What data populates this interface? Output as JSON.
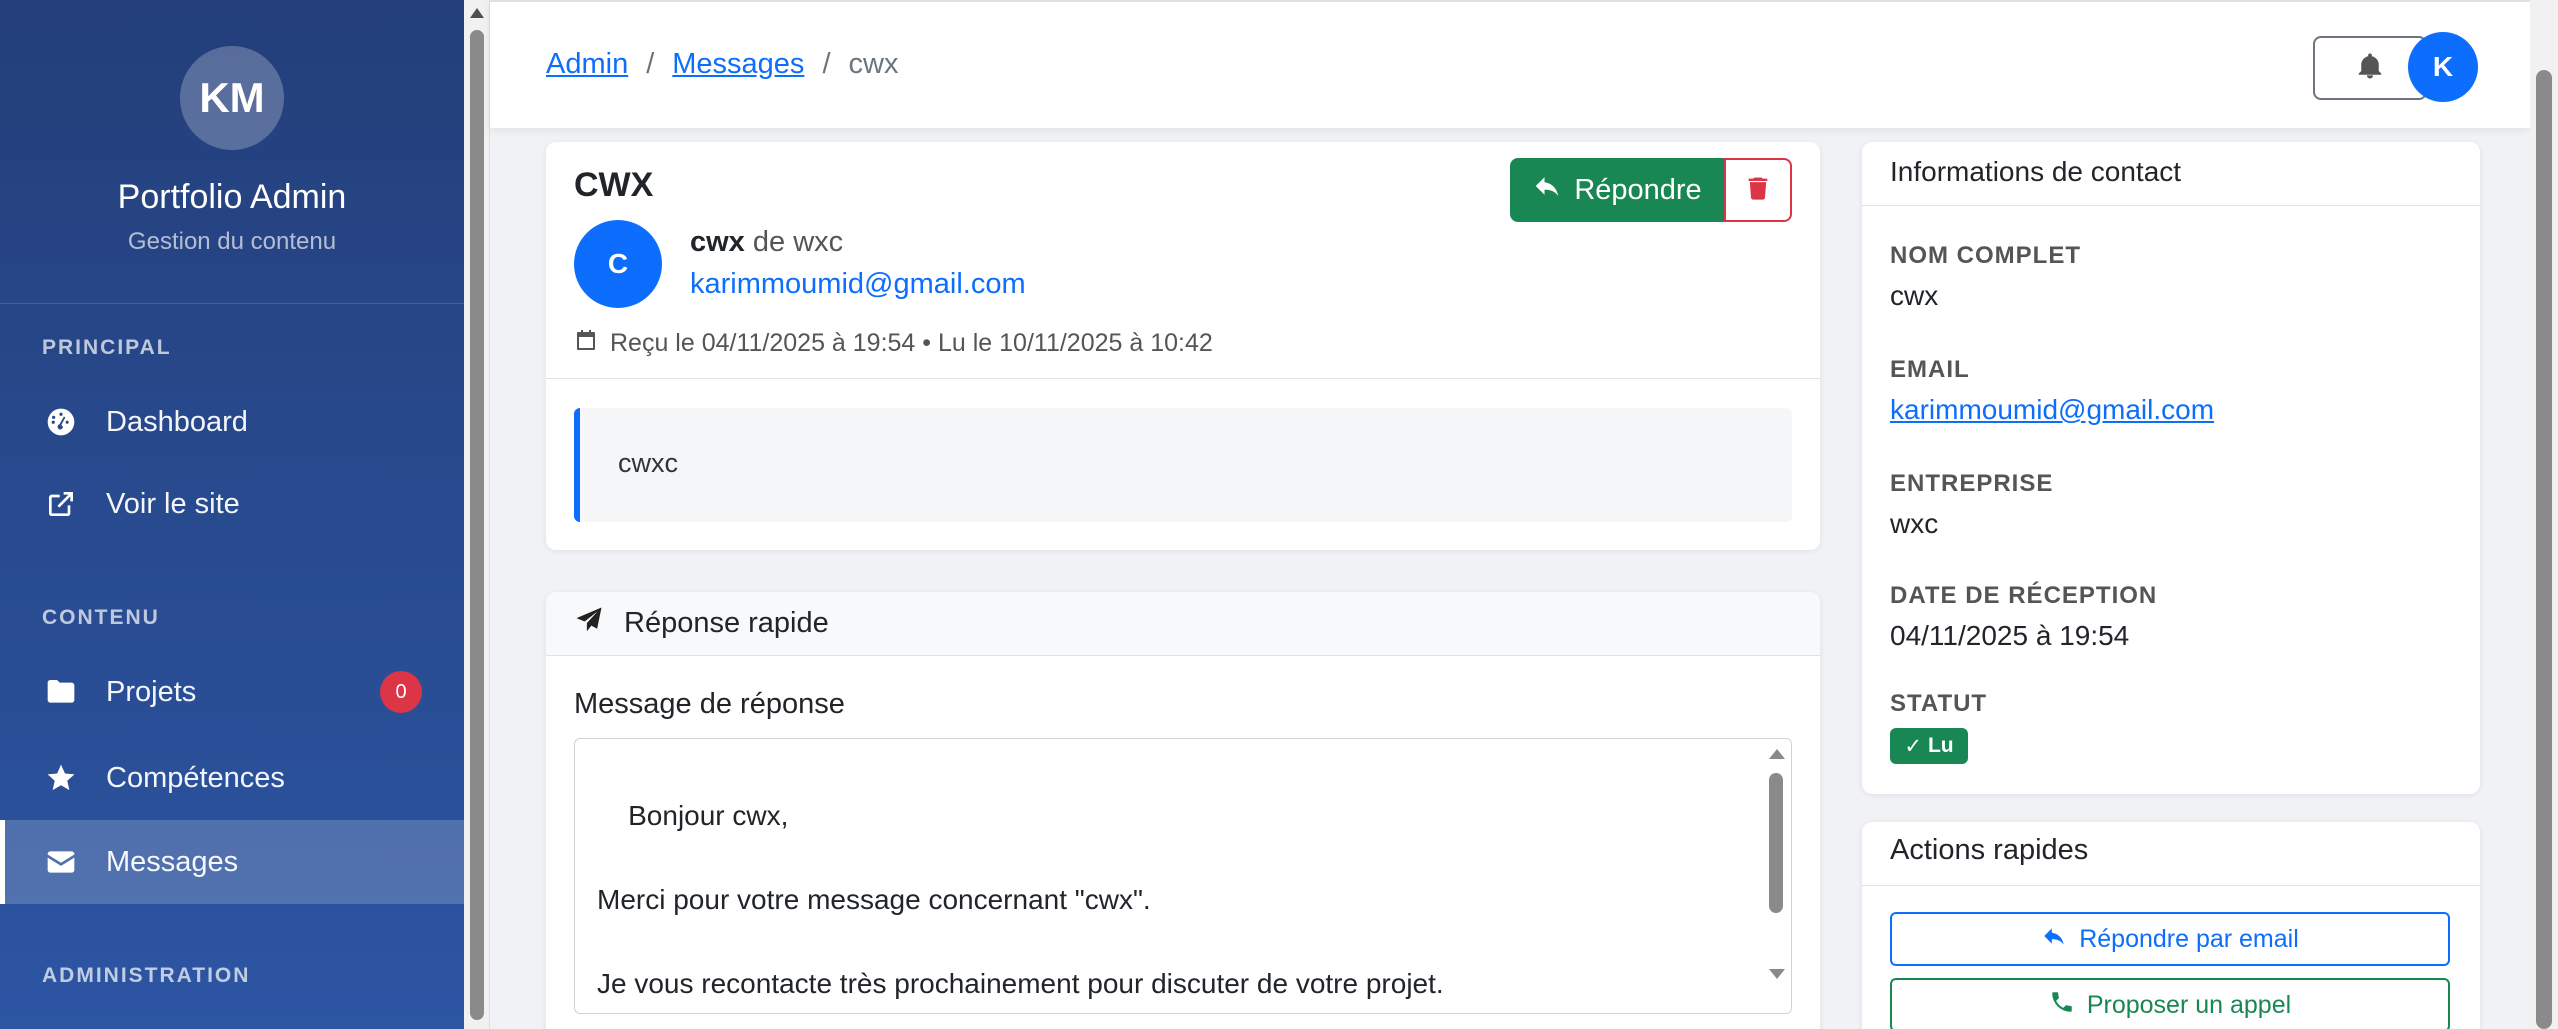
{
  "sidebar": {
    "avatar_initials": "KM",
    "title": "Portfolio Admin",
    "subtitle": "Gestion du contenu",
    "sections": {
      "principal": "PRINCIPAL",
      "contenu": "CONTENU",
      "administration": "ADMINISTRATION"
    },
    "items": {
      "dashboard": "Dashboard",
      "voir_site": "Voir le site",
      "projets": "Projets",
      "projets_badge": "0",
      "competences": "Compétences",
      "messages": "Messages"
    },
    "active_item": "Messages"
  },
  "header": {
    "breadcrumb": [
      "Admin",
      "/",
      "Messages",
      "/",
      "cwx"
    ],
    "user_initial": "K"
  },
  "message": {
    "title": "CWX",
    "reply_label": "Répondre",
    "sender_initial": "C",
    "sender_name": "cwx",
    "sender_company_prefix": "de wxc",
    "sender_email": "karimmoumid@gmail.com",
    "meta": "Reçu le 04/11/2025 à 19:54 • Lu le 10/11/2025 à 10:42",
    "body": "cwxc"
  },
  "quick_reply": {
    "title": "Réponse rapide",
    "field_label": "Message de réponse",
    "text": "Bonjour cwx,\n\nMerci pour votre message concernant \"cwx\".\n\nJe vous recontacte très prochainement pour discuter de votre projet."
  },
  "contact": {
    "title": "Informations de contact",
    "fields": [
      {
        "label": "NOM COMPLET",
        "value": "cwx"
      },
      {
        "label": "EMAIL",
        "value": "karimmoumid@gmail.com"
      },
      {
        "label": "ENTREPRISE",
        "value": "wxc"
      },
      {
        "label": "DATE DE RÉCEPTION",
        "value": "04/11/2025 à 19:54"
      },
      {
        "label": "STATUT",
        "value": "Lu"
      }
    ]
  },
  "actions": {
    "title": "Actions rapides",
    "reply_email": "Répondre par email",
    "propose_call": "Proposer un appel"
  },
  "colors": {
    "primary": "#0d6efd",
    "success": "#198754",
    "danger": "#dc3545",
    "sidebar_top": "#243f7a",
    "sidebar_bottom": "#2c55a3"
  },
  "icons": [
    "dashboard-icon",
    "external-link-icon",
    "folder-icon",
    "star-icon",
    "envelope-icon",
    "bell-icon",
    "reply-icon",
    "trash-icon",
    "calendar-icon",
    "paper-plane-icon",
    "check-icon",
    "phone-icon"
  ]
}
